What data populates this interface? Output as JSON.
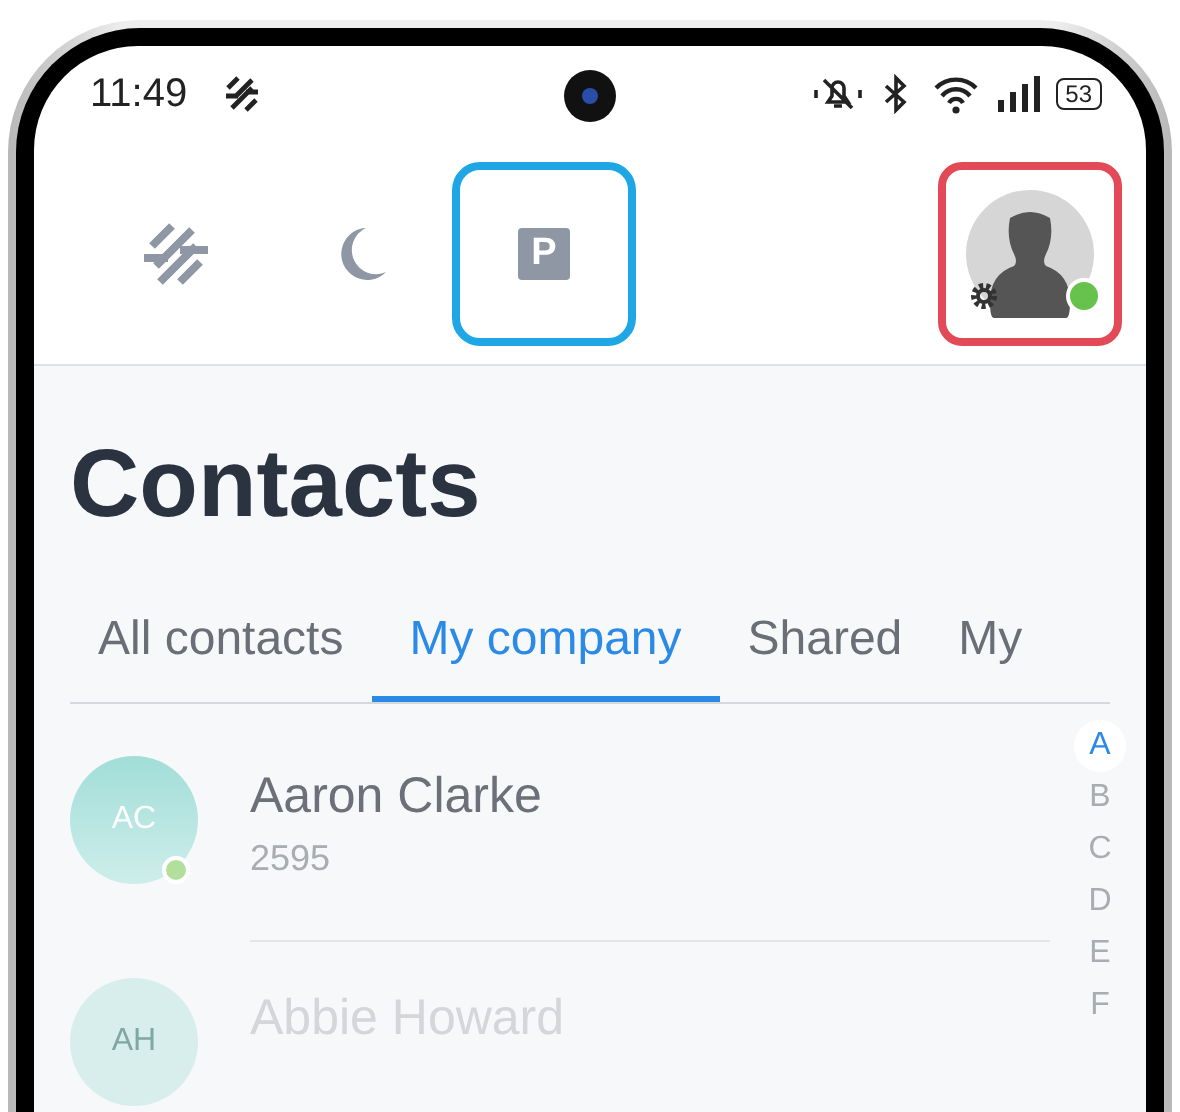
{
  "status_bar": {
    "time": "11:49",
    "battery": "53"
  },
  "toolbar": {
    "parking_label": "P",
    "parking_highlighted": true,
    "profile_highlighted": true,
    "profile_online": true
  },
  "title": "Contacts",
  "tabs": [
    {
      "label": "All contacts",
      "selected": false
    },
    {
      "label": "My company",
      "selected": true
    },
    {
      "label": "Shared",
      "selected": false
    },
    {
      "label": "My",
      "selected": false
    }
  ],
  "contacts": [
    {
      "initials": "AC",
      "name": "Aaron Clarke",
      "extension": "2595",
      "online": true,
      "faded": false
    },
    {
      "initials": "AH",
      "name": "Abbie Howard",
      "online": false,
      "faded": true
    }
  ],
  "index": [
    {
      "letter": "A",
      "selected": true
    },
    {
      "letter": "B",
      "selected": false
    },
    {
      "letter": "C",
      "selected": false
    },
    {
      "letter": "D",
      "selected": false
    },
    {
      "letter": "E",
      "selected": false
    },
    {
      "letter": "F",
      "selected": false
    }
  ]
}
